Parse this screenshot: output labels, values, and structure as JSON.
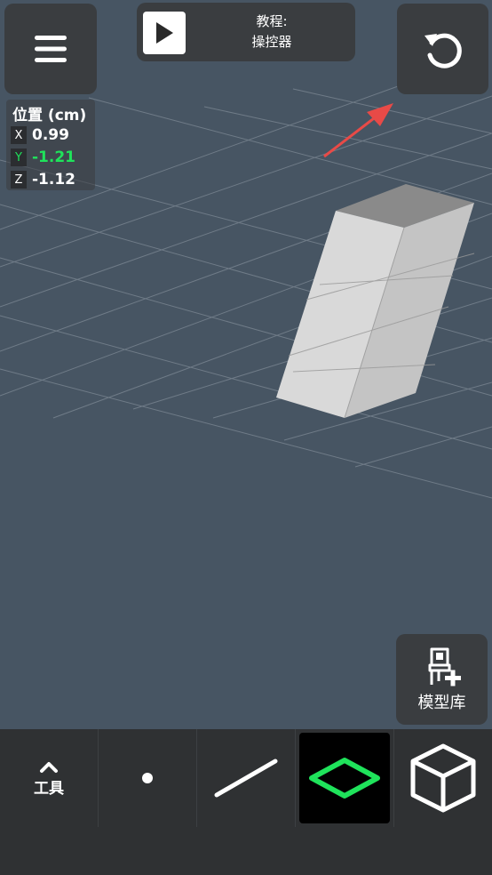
{
  "tutorial": {
    "prefix": "教程:",
    "title": "操控器"
  },
  "position": {
    "title": "位置 (cm)",
    "x_label": "X",
    "x_value": "0.99",
    "y_label": "Y",
    "y_value": "-1.21",
    "z_label": "Z",
    "z_value": "-1.12"
  },
  "model_library": {
    "label": "模型库"
  },
  "toolbar": {
    "tools_label": "工具",
    "active_tool": "plane"
  },
  "colors": {
    "background": "#475563",
    "accent_green": "#1fe35b",
    "arrow_red": "#e84a47",
    "panel": "#3a3d40"
  },
  "icons": [
    "menu-icon",
    "play-icon",
    "undo-icon",
    "chair-plus-icon",
    "chevron-up-icon",
    "point-icon",
    "line-icon",
    "plane-icon",
    "cube-icon"
  ]
}
